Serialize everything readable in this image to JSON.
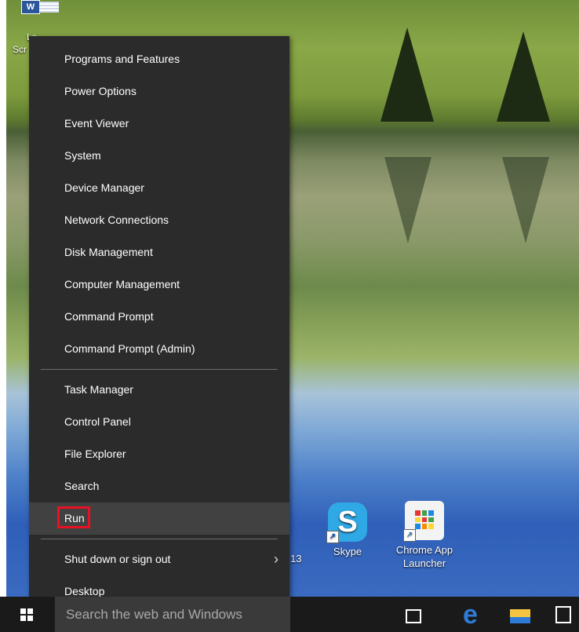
{
  "desktop": {
    "word_icon_text": "W",
    "label_fragment_a": "Lo",
    "label_fragment_b": "Scr",
    "partial_icon_label": "13",
    "skype_label": "Skype",
    "skype_glyph": "S",
    "chrome_launcher_label_line1": "Chrome App",
    "chrome_launcher_label_line2": "Launcher",
    "chrome_grid_colors": [
      "#e53935",
      "#43a047",
      "#1e88e5",
      "#fdd835",
      "#e53935",
      "#43a047",
      "#1e88e5",
      "#fb8c00",
      "#fdd835"
    ]
  },
  "menu": {
    "group1": [
      "Programs and Features",
      "Power Options",
      "Event Viewer",
      "System",
      "Device Manager",
      "Network Connections",
      "Disk Management",
      "Computer Management",
      "Command Prompt",
      "Command Prompt (Admin)"
    ],
    "group2": [
      "Task Manager",
      "Control Panel",
      "File Explorer",
      "Search",
      "Run"
    ],
    "group3": [
      "Shut down or sign out",
      "Desktop"
    ],
    "highlighted_item": "Run",
    "highlight_color": "#e81123",
    "submenu_arrow": "›"
  },
  "taskbar": {
    "search_placeholder": "Search the web and Windows",
    "icons": [
      "windows-logo-icon",
      "task-view-icon",
      "edge-icon",
      "file-explorer-icon",
      "store-icon"
    ]
  }
}
